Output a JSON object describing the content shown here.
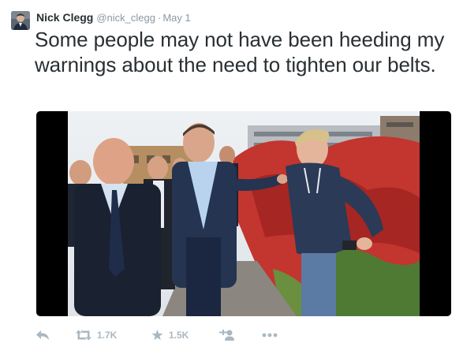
{
  "tweet": {
    "author_name": "Nick Clegg",
    "handle": "@nick_clegg",
    "separator": "·",
    "date": "May 1",
    "text": "Some people may not have been heeding my warnings about the need to tighten our belts."
  },
  "media": {
    "icon": "photo"
  },
  "actions": {
    "reply_icon": "reply-icon",
    "retweet_icon": "retweet-icon",
    "retweet_count": "1.7K",
    "favorite_icon": "star-icon",
    "favorite_count": "1.5K",
    "follow_icon": "add-user-icon",
    "more_icon": "more-dots-icon"
  },
  "colors": {
    "text": "#292f33",
    "muted": "#8899a6",
    "action": "#aab8c2"
  }
}
